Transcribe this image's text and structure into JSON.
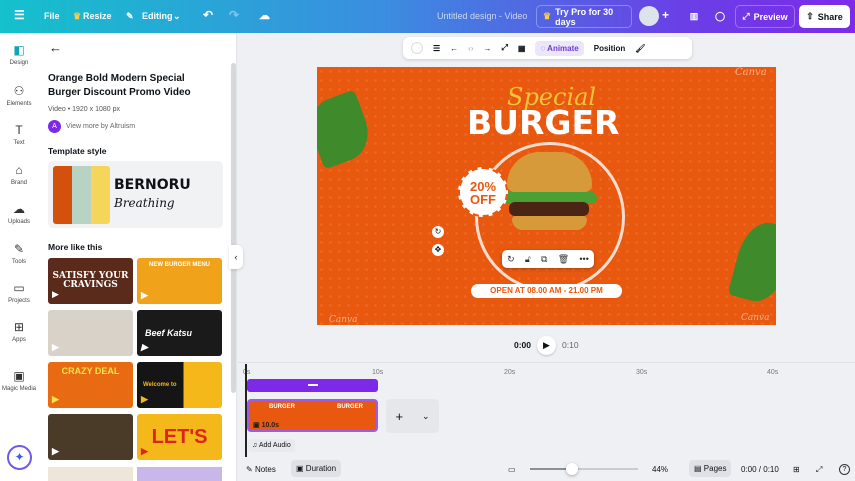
{
  "topbar": {
    "file": "File",
    "resize": "Resize",
    "editing": "Editing",
    "title": "Untitled design - Video",
    "try_pro": "Try Pro for 30 days",
    "preview": "Preview",
    "share": "Share"
  },
  "rail": [
    {
      "label": "Design"
    },
    {
      "label": "Elements"
    },
    {
      "label": "Text"
    },
    {
      "label": "Brand"
    },
    {
      "label": "Uploads"
    },
    {
      "label": "Tools"
    },
    {
      "label": "Projects"
    },
    {
      "label": "Apps"
    },
    {
      "label": "Magic Media"
    }
  ],
  "panel": {
    "title": "Orange Bold Modern Special Burger Discount Promo Video",
    "meta": "Video • 1920 x 1080 px",
    "author_initial": "A",
    "author": "View more by Altruism",
    "style_heading": "Template style",
    "font_heading": "BERNORU",
    "font_script": "Breathing",
    "swatches": [
      "#d4500d",
      "#b7d3c4",
      "#f6d65a"
    ],
    "more_heading": "More like this",
    "thumbs": [
      {
        "text": "SATISFY YOUR CRAVINGS",
        "bg": "#5a2a1a"
      },
      {
        "text": "NEW BURGER MENU",
        "bg": "#f0a21a"
      },
      {
        "text": "",
        "bg": "#d8d2c8"
      },
      {
        "text": "Beef Katsu",
        "bg": "#1a1a1a"
      },
      {
        "text": "CRAZY DEAL",
        "bg": "#e86a12"
      },
      {
        "text": "Welcome to",
        "bg": "#151515"
      },
      {
        "text": "",
        "bg": "#4a3a28"
      },
      {
        "text": "LET'S",
        "bg": "#f4b81a"
      }
    ]
  },
  "toolbar": {
    "animate": "Animate",
    "position": "Position"
  },
  "design": {
    "special": "Special",
    "burger": "BURGER",
    "discount_top": "20%",
    "discount_bottom": "OFF",
    "hours": "OPEN AT 08.00 AM - 21.00 PM",
    "watermark": "Canva"
  },
  "playback": {
    "current": "0:00",
    "total": "0:10"
  },
  "timeline": {
    "ticks": [
      "0s",
      "10s",
      "20s",
      "30s",
      "40s"
    ],
    "clip_duration": "10.0s",
    "add_audio": "Add Audio"
  },
  "bottombar": {
    "notes": "Notes",
    "duration": "Duration",
    "zoom": "44%",
    "zoom_fraction": 0.44,
    "pages": "Pages",
    "time": "0:00 / 0:10"
  }
}
